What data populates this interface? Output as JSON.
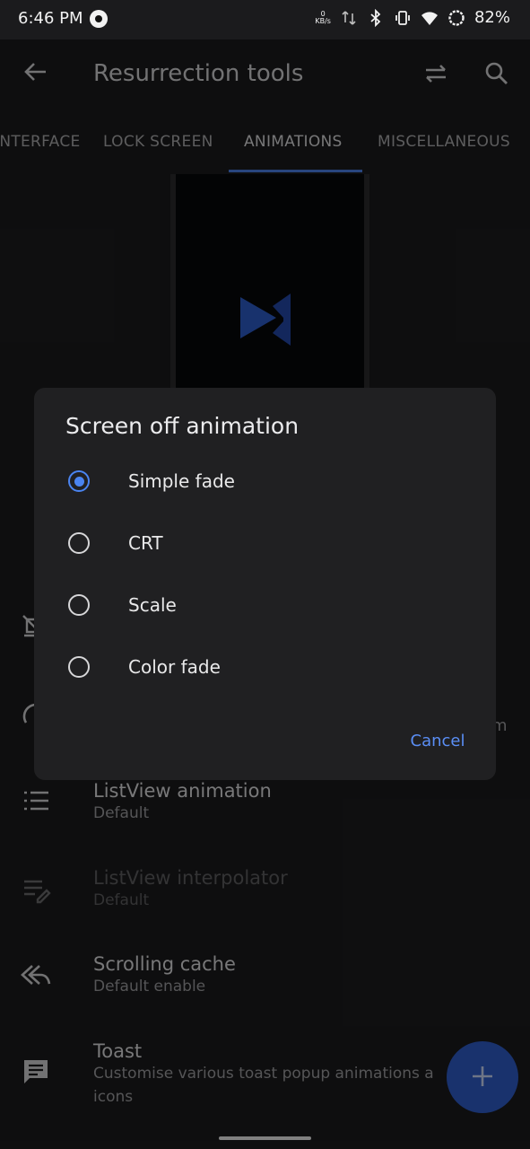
{
  "status_bar": {
    "time": "6:46 PM",
    "net_speed_value": "0",
    "net_speed_unit": "KB/s",
    "battery": "82%"
  },
  "app_bar": {
    "title": "Resurrection tools"
  },
  "tabs": [
    {
      "label": "INTERFACE"
    },
    {
      "label": "LOCK SCREEN"
    },
    {
      "label": "ANIMATIONS"
    },
    {
      "label": "MISCELLANEOUS"
    }
  ],
  "list_items": [
    {
      "title": "ListView animation",
      "subtitle": "Default"
    },
    {
      "title": "ListView interpolator",
      "subtitle": "Default"
    },
    {
      "title": "Scrolling cache",
      "subtitle": "Default enable"
    },
    {
      "title": "Toast",
      "subtitle": "Customise various toast popup animations a",
      "subtitle2": "icons"
    }
  ],
  "stray_text": "m",
  "dialog": {
    "title": "Screen off animation",
    "options": [
      {
        "label": "Simple fade"
      },
      {
        "label": "CRT"
      },
      {
        "label": "Scale"
      },
      {
        "label": "Color fade"
      }
    ],
    "cancel_label": "Cancel"
  },
  "colors": {
    "accent": "#4a84f0",
    "fab": "#2f5cc7",
    "background": "#1b1b1d",
    "dialog": "#202022"
  }
}
